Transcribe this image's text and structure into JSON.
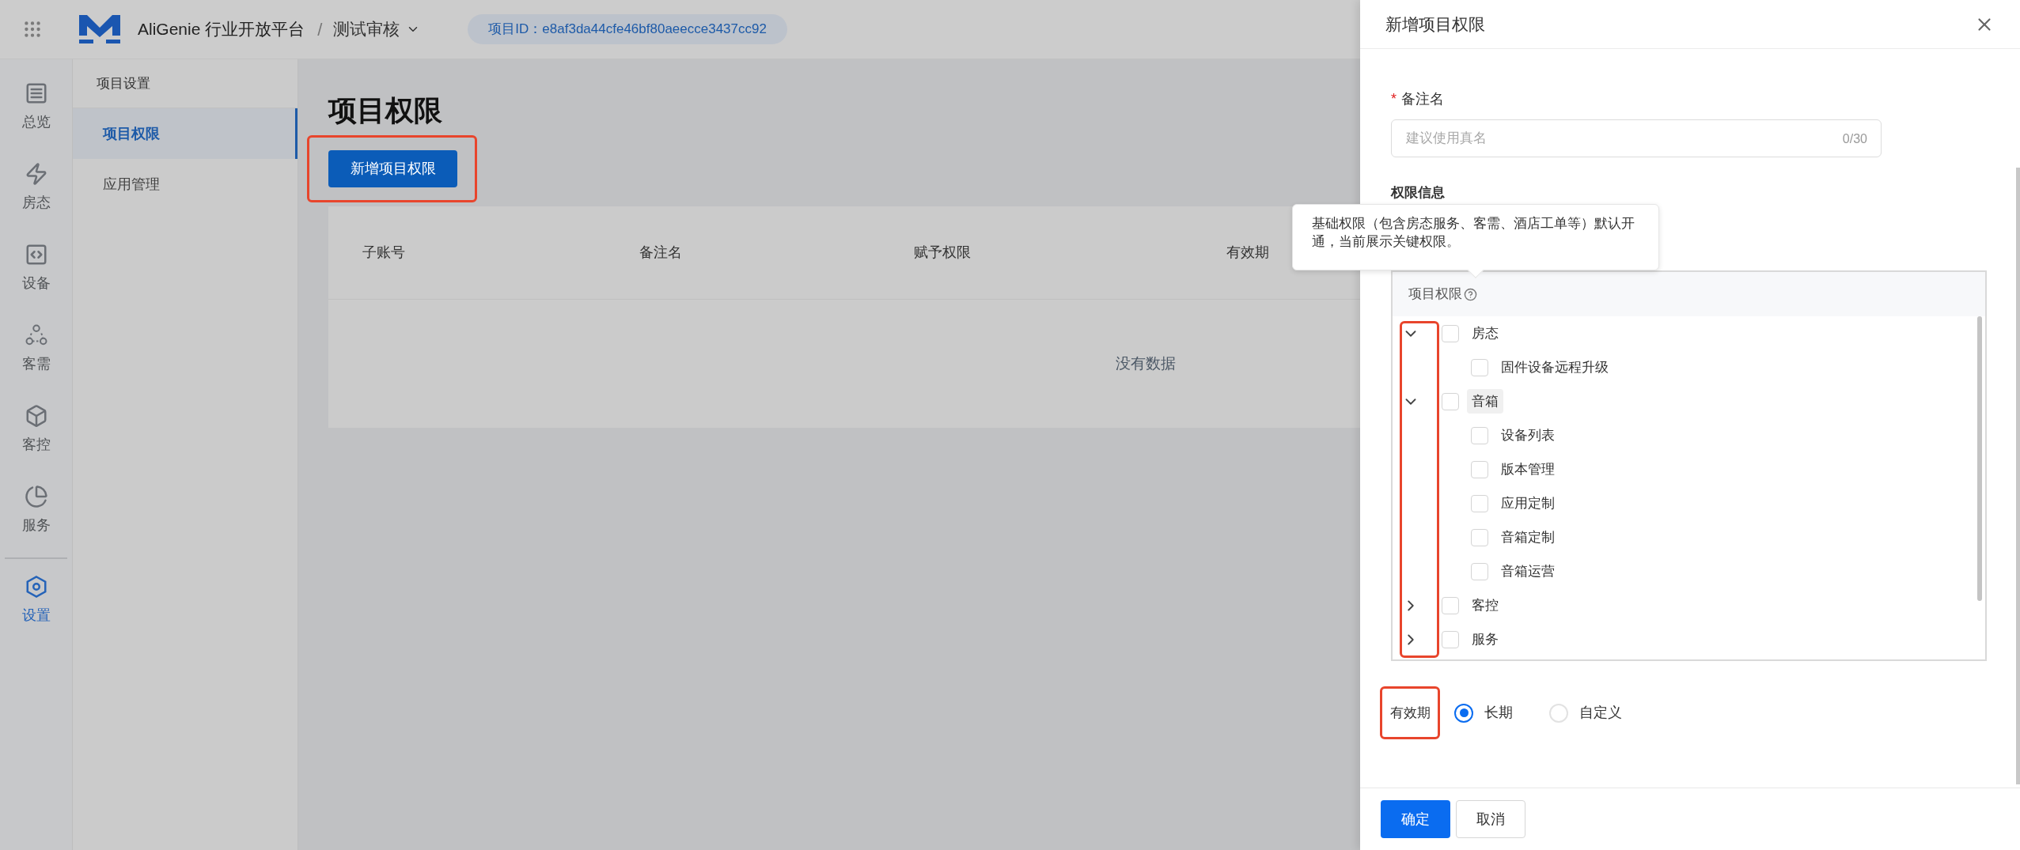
{
  "top_bar": {
    "app_name": "AliGenie 行业开放平台",
    "separator": "/",
    "project": "测试审核",
    "project_id": "项目ID：e8af3da44cfe46bf80aeecce3437cc92"
  },
  "nav_rail": [
    {
      "label": "总览",
      "selected": false
    },
    {
      "label": "房态",
      "selected": false
    },
    {
      "label": "设备",
      "selected": false
    },
    {
      "label": "客需",
      "selected": false
    },
    {
      "label": "客控",
      "selected": false
    },
    {
      "label": "服务",
      "selected": false
    },
    {
      "label": "设置",
      "selected": true
    }
  ],
  "sub_sidebar": {
    "title": "项目设置",
    "items": [
      {
        "label": "项目权限",
        "selected": true
      },
      {
        "label": "应用管理",
        "selected": false
      }
    ]
  },
  "page": {
    "title": "项目权限",
    "add_button": "新增项目权限",
    "table": {
      "columns": [
        "子账号",
        "备注名",
        "赋予权限",
        "有效期"
      ],
      "empty_text": "没有数据"
    }
  },
  "drawer": {
    "title": "新增项目权限",
    "remark_field": {
      "label": "备注名",
      "required_mark": "*",
      "placeholder": "建议使用真名",
      "counter": "0/30"
    },
    "section_title": "权限信息",
    "tooltip": "基础权限（包含房态服务、客需、酒店工单等）默认开通，当前展示关键权限。",
    "tree": {
      "header": "项目权限",
      "items": [
        {
          "label": "房态",
          "checked": false,
          "expanded": true,
          "highlighted": false,
          "children": [
            {
              "label": "固件设备远程升级",
              "checked": false
            }
          ]
        },
        {
          "label": "音箱",
          "checked": false,
          "expanded": true,
          "highlighted": true,
          "children": [
            {
              "label": "设备列表",
              "checked": false
            },
            {
              "label": "版本管理",
              "checked": false
            },
            {
              "label": "应用定制",
              "checked": false
            },
            {
              "label": "音箱定制",
              "checked": false
            },
            {
              "label": "音箱运营",
              "checked": false
            }
          ]
        },
        {
          "label": "客控",
          "checked": false,
          "expanded": false,
          "highlighted": false
        },
        {
          "label": "服务",
          "checked": false,
          "expanded": false,
          "highlighted": false
        }
      ]
    },
    "validity": {
      "label": "有效期",
      "options": [
        {
          "label": "长期",
          "selected": true
        },
        {
          "label": "自定义",
          "selected": false
        }
      ]
    },
    "buttons": [
      {
        "label": "确定",
        "kind": "primary"
      },
      {
        "label": "取消",
        "kind": "default"
      }
    ]
  }
}
